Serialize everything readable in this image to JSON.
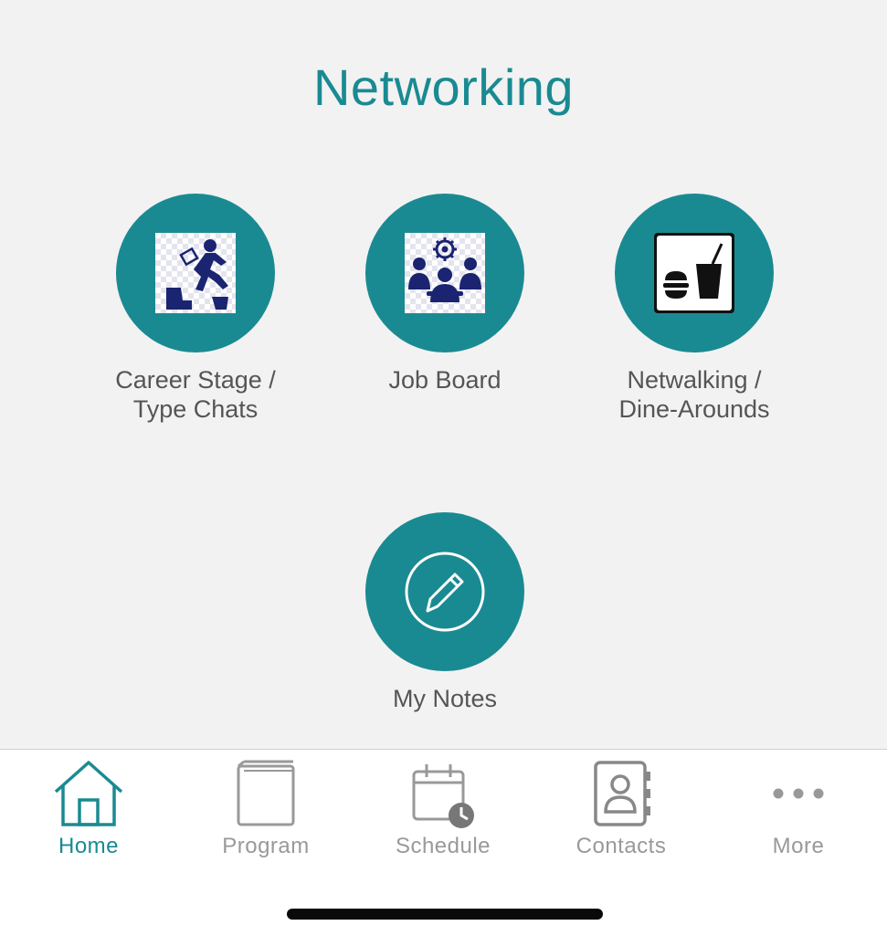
{
  "page": {
    "title": "Networking"
  },
  "tiles": [
    {
      "label": "Career Stage /\nType Chats",
      "icon": "career-climb-icon"
    },
    {
      "label": "Job Board",
      "icon": "meeting-gear-icon"
    },
    {
      "label": "Netwalking /\nDine-Arounds",
      "icon": "burger-drink-icon"
    },
    {
      "label": "My Notes",
      "icon": "pencil-icon"
    }
  ],
  "tabbar": {
    "items": [
      {
        "label": "Home",
        "icon": "home-icon",
        "active": true
      },
      {
        "label": "Program",
        "icon": "book-icon",
        "active": false
      },
      {
        "label": "Schedule",
        "icon": "calendar-clock-icon",
        "active": false
      },
      {
        "label": "Contacts",
        "icon": "contact-book-icon",
        "active": false
      },
      {
        "label": "More",
        "icon": "more-dots-icon",
        "active": false
      }
    ]
  },
  "colors": {
    "accent": "#1a8a92",
    "inactive": "#999999",
    "background": "#f2f2f2"
  }
}
